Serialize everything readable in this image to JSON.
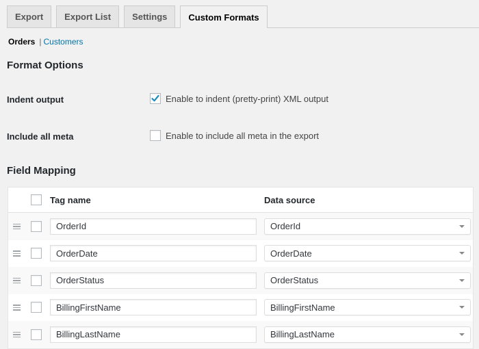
{
  "tabs": [
    {
      "label": "Export",
      "active": false
    },
    {
      "label": "Export List",
      "active": false
    },
    {
      "label": "Settings",
      "active": false
    },
    {
      "label": "Custom Formats",
      "active": true
    }
  ],
  "subnav": {
    "current": "Orders",
    "separator": "|",
    "link": "Customers"
  },
  "format_options": {
    "heading": "Format Options",
    "options": [
      {
        "label": "Indent output",
        "checkbox_label": "Enable to indent (pretty-print) XML output",
        "checked": true
      },
      {
        "label": "Include all meta",
        "checkbox_label": "Enable to include all meta in the export",
        "checked": false
      }
    ]
  },
  "field_mapping": {
    "heading": "Field Mapping",
    "columns": {
      "tag_name": "Tag name",
      "data_source": "Data source"
    },
    "rows": [
      {
        "tag": "OrderId",
        "source": "OrderId"
      },
      {
        "tag": "OrderDate",
        "source": "OrderDate"
      },
      {
        "tag": "OrderStatus",
        "source": "OrderStatus"
      },
      {
        "tag": "BillingFirstName",
        "source": "BillingFirstName"
      },
      {
        "tag": "BillingLastName",
        "source": "BillingLastName"
      }
    ]
  },
  "colors": {
    "link": "#0073aa",
    "checkmark": "#1e8cbe",
    "background": "#f1f1f1"
  }
}
